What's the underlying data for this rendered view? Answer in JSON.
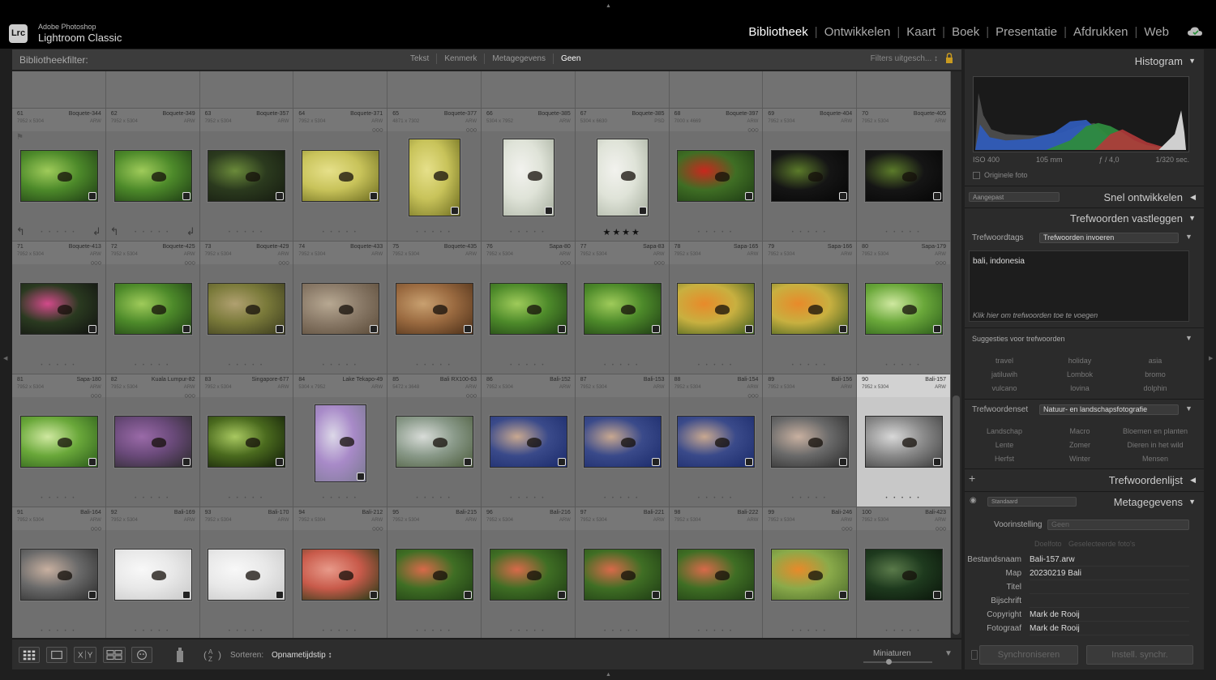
{
  "app": {
    "logo": "Lrc",
    "brand_small": "Adobe Photoshop",
    "brand_large": "Lightroom Classic"
  },
  "modules": [
    {
      "label": "Bibliotheek",
      "active": true
    },
    {
      "label": "Ontwikkelen",
      "active": false
    },
    {
      "label": "Kaart",
      "active": false
    },
    {
      "label": "Boek",
      "active": false
    },
    {
      "label": "Presentatie",
      "active": false
    },
    {
      "label": "Afdrukken",
      "active": false
    },
    {
      "label": "Web",
      "active": false
    }
  ],
  "filter": {
    "title": "Bibliotheekfilter:",
    "tabs": [
      {
        "label": "Tekst"
      },
      {
        "label": "Kenmerk"
      },
      {
        "label": "Metagegevens"
      },
      {
        "label": "Geen",
        "active": true
      }
    ],
    "status": "Filters uitgesch... ↕"
  },
  "grid": {
    "rows": [
      [
        {
          "num": "61",
          "name": "Boquete-344",
          "dim": "7952 x 5304",
          "ext": "ARW",
          "shape": "land",
          "img": "leaf-green",
          "more": false,
          "flag": true,
          "rot": true
        },
        {
          "num": "62",
          "name": "Boquete-349",
          "dim": "7952 x 5304",
          "ext": "ARW",
          "shape": "land",
          "img": "leaf-green",
          "more": false,
          "rot": true
        },
        {
          "num": "63",
          "name": "Boquete-357",
          "dim": "7952 x 5304",
          "ext": "ARW",
          "shape": "land",
          "img": "dark-green",
          "more": false
        },
        {
          "num": "64",
          "name": "Boquete-371",
          "dim": "7952 x 5304",
          "ext": "ARW",
          "shape": "land",
          "img": "yellow",
          "more": true
        },
        {
          "num": "65",
          "name": "Boquete-377",
          "dim": "4871 x 7302",
          "ext": "ARW",
          "shape": "port",
          "img": "yellow",
          "more": true
        },
        {
          "num": "66",
          "name": "Boquete-385",
          "dim": "5304 x 7952",
          "ext": "ARW",
          "shape": "port",
          "img": "pale",
          "more": false
        },
        {
          "num": "67",
          "name": "Boquete-385",
          "dim": "5304 x 6630",
          "ext": "PSD",
          "shape": "port",
          "img": "pale",
          "more": false,
          "stars": "★★★★"
        },
        {
          "num": "68",
          "name": "Boquete-397",
          "dim": "7000 x 4669",
          "ext": "ARW",
          "shape": "land",
          "img": "red-green",
          "more": true
        },
        {
          "num": "69",
          "name": "Boquete-404",
          "dim": "7952 x 5304",
          "ext": "ARW",
          "shape": "land",
          "img": "dark",
          "more": false
        },
        {
          "num": "70",
          "name": "Boquete-405",
          "dim": "7952 x 5304",
          "ext": "ARW",
          "shape": "land",
          "img": "dark",
          "more": false
        }
      ],
      [
        {
          "num": "71",
          "name": "Boquete-413",
          "dim": "7952 x 5304",
          "ext": "ARW",
          "shape": "land",
          "img": "dark-pink",
          "more": true
        },
        {
          "num": "72",
          "name": "Boquete-425",
          "dim": "7952 x 5304",
          "ext": "ARW",
          "shape": "land",
          "img": "leaf-green",
          "more": true
        },
        {
          "num": "73",
          "name": "Boquete-429",
          "dim": "7952 x 5304",
          "ext": "ARW",
          "shape": "land",
          "img": "olive",
          "more": true
        },
        {
          "num": "74",
          "name": "Boquete-433",
          "dim": "7952 x 5304",
          "ext": "ARW",
          "shape": "land",
          "img": "wood",
          "more": false
        },
        {
          "num": "75",
          "name": "Boquete-435",
          "dim": "7952 x 5304",
          "ext": "ARW",
          "shape": "land",
          "img": "wood2",
          "more": false
        },
        {
          "num": "76",
          "name": "Sapa-80",
          "dim": "7952 x 5304",
          "ext": "ARW",
          "shape": "land",
          "img": "leaf-green",
          "more": true
        },
        {
          "num": "77",
          "name": "Sapa-83",
          "dim": "7952 x 5304",
          "ext": "ARW",
          "shape": "land",
          "img": "leaf-green",
          "more": true
        },
        {
          "num": "78",
          "name": "Sapa-165",
          "dim": "7952 x 5304",
          "ext": "ARW",
          "shape": "land",
          "img": "flowers",
          "more": false
        },
        {
          "num": "79",
          "name": "Sapa-166",
          "dim": "7952 x 5304",
          "ext": "ARW",
          "shape": "land",
          "img": "flowers",
          "more": false
        },
        {
          "num": "80",
          "name": "Sapa-179",
          "dim": "7952 x 5304",
          "ext": "ARW",
          "shape": "land",
          "img": "bright-green",
          "more": true
        }
      ],
      [
        {
          "num": "81",
          "name": "Sapa-180",
          "dim": "7952 x 5304",
          "ext": "ARW",
          "shape": "land",
          "img": "bright-green",
          "more": true
        },
        {
          "num": "82",
          "name": "Kuala Lumpur-82",
          "dim": "7952 x 5304",
          "ext": "ARW",
          "shape": "land",
          "img": "purple",
          "more": true
        },
        {
          "num": "83",
          "name": "Singapore-677",
          "dim": "7952 x 5304",
          "ext": "ARW",
          "shape": "land",
          "img": "leaf-back",
          "more": false
        },
        {
          "num": "84",
          "name": "Lake Tekapo-49",
          "dim": "5304 x 7952",
          "ext": "ARW",
          "shape": "port",
          "img": "lupine",
          "more": false
        },
        {
          "num": "85",
          "name": "Bali RX100-63",
          "dim": "5472 x 3648",
          "ext": "ARW",
          "shape": "land",
          "img": "garden",
          "more": true
        },
        {
          "num": "86",
          "name": "Bali-152",
          "dim": "7952 x 5304",
          "ext": "ARW",
          "shape": "land",
          "img": "hand-blue",
          "more": false
        },
        {
          "num": "87",
          "name": "Bali-153",
          "dim": "7952 x 5304",
          "ext": "ARW",
          "shape": "land",
          "img": "hand-blue",
          "more": false
        },
        {
          "num": "88",
          "name": "Bali-154",
          "dim": "7952 x 5304",
          "ext": "ARW",
          "shape": "land",
          "img": "hand-blue",
          "more": true
        },
        {
          "num": "89",
          "name": "Bali-156",
          "dim": "7952 x 5304",
          "ext": "ARW",
          "shape": "land",
          "img": "hand-grey",
          "more": false
        },
        {
          "num": "90",
          "name": "Bali-157",
          "dim": "7952 x 5304",
          "ext": "ARW",
          "shape": "land",
          "img": "net",
          "more": false,
          "selected": true
        }
      ],
      [
        {
          "num": "91",
          "name": "Bali-164",
          "dim": "7952 x 5304",
          "ext": "ARW",
          "shape": "land",
          "img": "hand-grey",
          "more": true
        },
        {
          "num": "92",
          "name": "Bali-169",
          "dim": "7952 x 5304",
          "ext": "ARW",
          "shape": "land",
          "img": "white",
          "more": false
        },
        {
          "num": "93",
          "name": "Bali-170",
          "dim": "7952 x 5304",
          "ext": "ARW",
          "shape": "land",
          "img": "white",
          "more": false
        },
        {
          "num": "94",
          "name": "Bali-212",
          "dim": "7952 x 5304",
          "ext": "ARW",
          "shape": "land",
          "img": "coral",
          "more": true
        },
        {
          "num": "95",
          "name": "Bali-215",
          "dim": "7952 x 5304",
          "ext": "ARW",
          "shape": "land",
          "img": "coral-green",
          "more": false
        },
        {
          "num": "96",
          "name": "Bali-216",
          "dim": "7952 x 5304",
          "ext": "ARW",
          "shape": "land",
          "img": "coral-green",
          "more": false
        },
        {
          "num": "97",
          "name": "Bali-221",
          "dim": "7952 x 5304",
          "ext": "ARW",
          "shape": "land",
          "img": "coral-green",
          "more": false
        },
        {
          "num": "98",
          "name": "Bali-222",
          "dim": "7952 x 5304",
          "ext": "ARW",
          "shape": "land",
          "img": "coral-green",
          "more": false
        },
        {
          "num": "99",
          "name": "Bali-246",
          "dim": "7952 x 5304",
          "ext": "ARW",
          "shape": "land",
          "img": "orange-bf",
          "more": true
        },
        {
          "num": "100",
          "name": "Bali-423",
          "dim": "7952 x 5304",
          "ext": "ARW",
          "shape": "land",
          "img": "dark-forest",
          "more": true
        }
      ]
    ]
  },
  "toolbar": {
    "sort_label": "Sorteren:",
    "sort_value": "Opnametijdstip ↕",
    "thumbs_label": "Miniaturen"
  },
  "panels": {
    "histogram": {
      "title": "Histogram",
      "iso": "ISO 400",
      "focal": "105 mm",
      "aperture": "ƒ / 4,0",
      "shutter": "1/320 sec.",
      "original": "Originele foto"
    },
    "quick_develop": {
      "title": "Snel ontwikkelen",
      "preset": "Aangepast"
    },
    "keywording": {
      "title": "Trefwoorden vastleggen",
      "tags_label": "Trefwoordtags",
      "tags_mode": "Trefwoorden invoeren",
      "keywords": "bali, indonesia",
      "hint": "Klik hier om trefwoorden toe te voegen",
      "suggestions_label": "Suggesties voor trefwoorden",
      "suggestions": [
        "travel",
        "holiday",
        "asia",
        "jatiluwih",
        "Lombok",
        "bromo",
        "vulcano",
        "lovina",
        "dolphin"
      ],
      "set_label": "Trefwoordenset",
      "set_value": "Natuur- en landschapsfotografie",
      "set_items": [
        "Landschap",
        "Macro",
        "Bloemen en planten",
        "Lente",
        "Zomer",
        "Dieren in het wild",
        "Herfst",
        "Winter",
        "Mensen"
      ]
    },
    "keyword_list": {
      "title": "Trefwoordenlijst"
    },
    "metadata": {
      "title": "Metagegevens",
      "view": "Standaard",
      "preset_label": "Voorinstelling",
      "preset_value": "Geen",
      "target_photo": "Doelfoto",
      "selected_photos": "Geselecteerde foto's",
      "fields": [
        {
          "label": "Bestandsnaam",
          "value": "Bali-157.arw"
        },
        {
          "label": "Map",
          "value": "20230219 Bali"
        },
        {
          "label": "Titel",
          "value": ""
        },
        {
          "label": "Bijschrift",
          "value": ""
        },
        {
          "label": "Copyright",
          "value": "Mark de Rooij"
        },
        {
          "label": "Fotograaf",
          "value": "Mark de Rooij"
        }
      ]
    },
    "sync": {
      "sync_label": "Synchroniseren",
      "settings_label": "Instell. synchr."
    }
  },
  "colors": {
    "accent": "#ffffff",
    "selected_cell": "#c8c8c8",
    "grid_bg": "#6f6f6f"
  }
}
